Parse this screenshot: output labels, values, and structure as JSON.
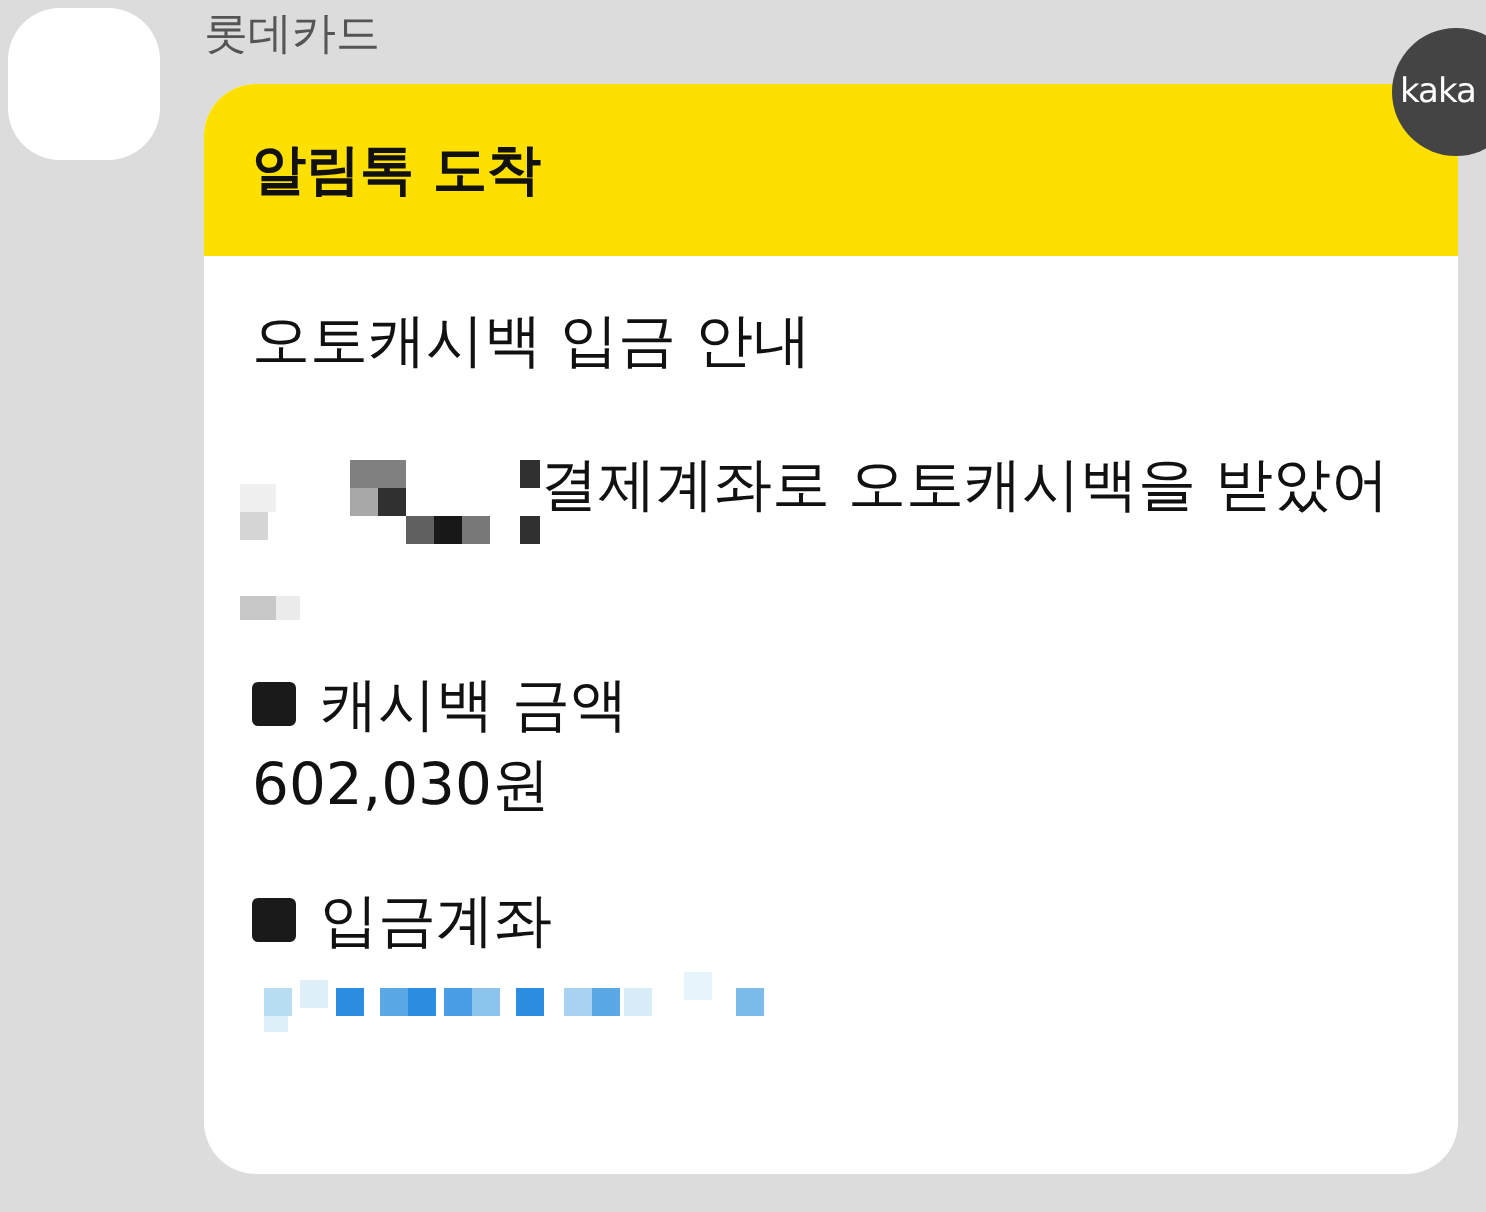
{
  "sender": {
    "name": "롯데카드"
  },
  "badge": {
    "text": "kaka"
  },
  "message": {
    "header": "알림톡 도착",
    "title": "오토캐시백 입금 안내",
    "intro": "결제계좌로 오토캐시백을 받았어",
    "sections": [
      {
        "label": "캐시백 금액",
        "value": "602,030원"
      },
      {
        "label": "입금계좌"
      }
    ]
  }
}
